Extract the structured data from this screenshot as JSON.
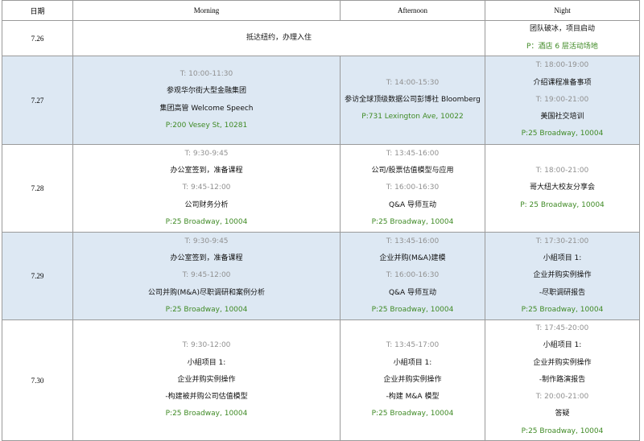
{
  "colors": {
    "border": "#9a9a9a",
    "shaded_row": "#dde8f3",
    "time": "#909090",
    "place": "#3f8a25",
    "text": "#111111"
  },
  "header": {
    "date": "日期",
    "morning": "Morning",
    "afternoon": "Afternoon",
    "night": "Night"
  },
  "rows": [
    {
      "date": "7.26",
      "merged": "抵达纽约，办理入住",
      "night": [
        {
          "k": "x",
          "v": "团队破冰，项目启动"
        },
        {
          "k": "p",
          "v": "P：酒店 6 层活动场地"
        }
      ]
    },
    {
      "date": "7.27",
      "morning": [
        {
          "k": "t",
          "v": "T: 10:00-11:30"
        },
        {
          "k": "x",
          "v": "参观华尔街大型金融集团"
        },
        {
          "k": "x",
          "v": "集团高管 Welcome Speech"
        },
        {
          "k": "p",
          "v": "P:200 Vesey St, 10281"
        }
      ],
      "afternoon": [
        {
          "k": "t",
          "v": "T: 14:00-15:30"
        },
        {
          "k": "x",
          "v": "参访全球顶级数据公司彭博社 Bloomberg"
        },
        {
          "k": "p",
          "v": "P:731 Lexington Ave, 10022"
        }
      ],
      "night": [
        {
          "k": "t",
          "v": "T: 18:00-19:00"
        },
        {
          "k": "x",
          "v": "介绍课程准备事项"
        },
        {
          "k": "t",
          "v": "T: 19:00-21:00"
        },
        {
          "k": "x",
          "v": "美国社交培训"
        },
        {
          "k": "p",
          "v": "P:25 Broadway, 10004"
        }
      ]
    },
    {
      "date": "7.28",
      "morning": [
        {
          "k": "t",
          "v": "T: 9:30-9:45"
        },
        {
          "k": "x",
          "v": "办公室签到，准备课程"
        },
        {
          "k": "t",
          "v": "T: 9:45-12:00"
        },
        {
          "k": "x",
          "v": "公司财务分析"
        },
        {
          "k": "p",
          "v": "P:25 Broadway, 10004"
        }
      ],
      "afternoon": [
        {
          "k": "t",
          "v": "T: 13:45-16:00"
        },
        {
          "k": "x",
          "v": "公司/股票估值模型与应用"
        },
        {
          "k": "t",
          "v": "T: 16:00-16:30"
        },
        {
          "k": "x",
          "v": "Q&A 导师互动"
        },
        {
          "k": "p",
          "v": "P:25 Broadway, 10004"
        }
      ],
      "night": [
        {
          "k": "t",
          "v": "T: 18:00-21:00"
        },
        {
          "k": "x",
          "v": "哥大纽大校友分享会"
        },
        {
          "k": "p",
          "v": "P: 25 Broadway, 10004"
        }
      ]
    },
    {
      "date": "7.29",
      "morning": [
        {
          "k": "t",
          "v": "T: 9:30-9:45"
        },
        {
          "k": "x",
          "v": "办公室签到，准备课程"
        },
        {
          "k": "t",
          "v": "T: 9:45-12:00"
        },
        {
          "k": "x",
          "v": "公司并购(M&A)尽职调研和案例分析"
        },
        {
          "k": "p",
          "v": "P:25 Broadway, 10004"
        }
      ],
      "afternoon": [
        {
          "k": "t",
          "v": "T: 13:45-16:00"
        },
        {
          "k": "x",
          "v": "企业并购(M&A)建模"
        },
        {
          "k": "t",
          "v": "T: 16:00-16:30"
        },
        {
          "k": "x",
          "v": "Q&A 导师互动"
        },
        {
          "k": "p",
          "v": "P:25 Broadway, 10004"
        }
      ],
      "night": [
        {
          "k": "t",
          "v": "T: 17:30-21:00"
        },
        {
          "k": "x",
          "v": "小組项目 1:"
        },
        {
          "k": "x",
          "v": "企业并购实例操作"
        },
        {
          "k": "x",
          "v": "-尽职调研报告"
        },
        {
          "k": "p",
          "v": "P:25 Broadway, 10004"
        }
      ]
    },
    {
      "date": "7.30",
      "morning": [
        {
          "k": "t",
          "v": "T: 9:30-12:00"
        },
        {
          "k": "x",
          "v": "小組项目 1:"
        },
        {
          "k": "x",
          "v": "企业并购实例操作"
        },
        {
          "k": "x",
          "v": "-构建被并购公司估值模型"
        },
        {
          "k": "p",
          "v": "P:25 Broadway, 10004"
        }
      ],
      "afternoon": [
        {
          "k": "t",
          "v": "T: 13:45-17:00"
        },
        {
          "k": "x",
          "v": "小組项目 1:"
        },
        {
          "k": "x",
          "v": "企业并购实例操作"
        },
        {
          "k": "x",
          "v": "-构建 M&A 模型"
        },
        {
          "k": "p",
          "v": "P:25 Broadway, 10004"
        }
      ],
      "night": [
        {
          "k": "t",
          "v": "T: 17:45-20:00"
        },
        {
          "k": "x",
          "v": "小組项目 1:"
        },
        {
          "k": "x",
          "v": "企业并购实例操作"
        },
        {
          "k": "x",
          "v": "-制作路演报告"
        },
        {
          "k": "t",
          "v": "T: 20:00-21:00"
        },
        {
          "k": "x",
          "v": "答疑"
        },
        {
          "k": "p",
          "v": "P:25 Broadway, 10004"
        }
      ]
    }
  ]
}
